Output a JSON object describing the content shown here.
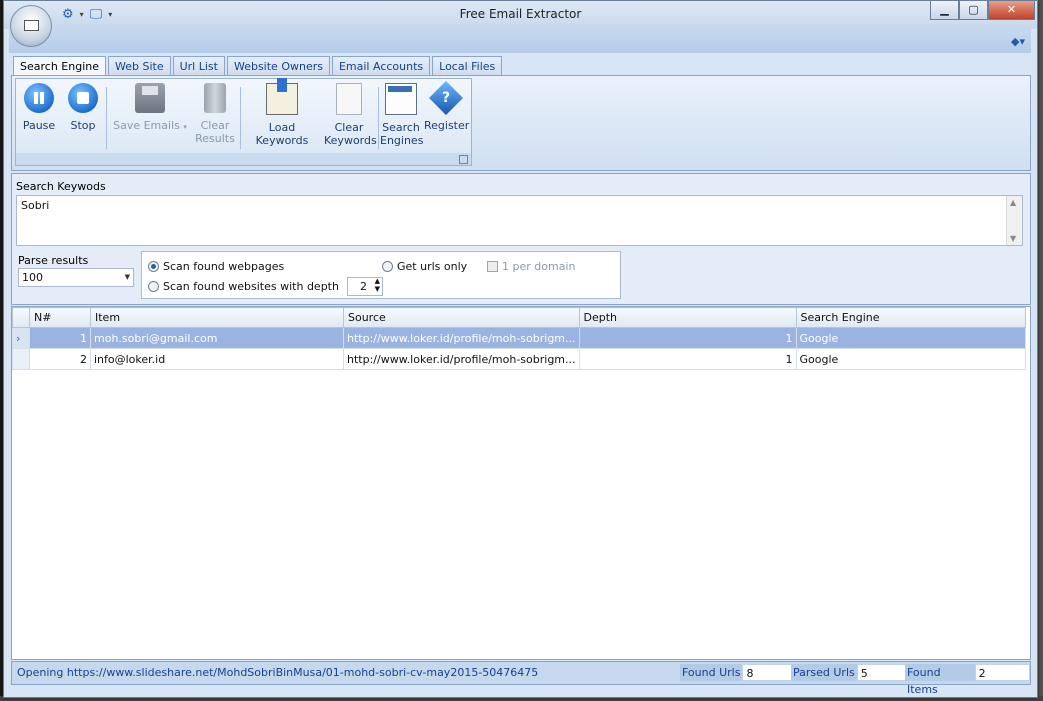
{
  "app": {
    "title": "Free Email Extractor"
  },
  "tabs": [
    "Search Engine",
    "Web Site",
    "Url List",
    "Website Owners",
    "Email Accounts",
    "Local Files"
  ],
  "ribbon": {
    "pause": "Pause",
    "stop": "Stop",
    "save_emails": "Save Emails",
    "clear_results": [
      "Clear",
      "Results"
    ],
    "load_keywords": "Load Keywords",
    "clear_keywords": [
      "Clear",
      "Keywords"
    ],
    "search_engines": [
      "Search",
      "Engines"
    ],
    "register": "Register"
  },
  "search": {
    "keywords_label": "Search Keywods",
    "keywords_value": "Sobri",
    "parse_label": "Parse results",
    "parse_value": "100",
    "opt_scan_found": "Scan found webpages",
    "opt_scan_depth": "Scan found websites with depth",
    "depth_value": "2",
    "opt_get_urls": "Get urls only",
    "opt_one_per_domain": "1 per domain"
  },
  "table": {
    "columns": [
      "N#",
      "Item",
      "Source",
      "Depth",
      "Search Engine"
    ],
    "rows": [
      {
        "n": "1",
        "item": "moh.sobri@gmail.com",
        "source": "http://www.loker.id/profile/moh-sobrigm...",
        "depth": "1",
        "engine": "Google"
      },
      {
        "n": "2",
        "item": "info@loker.id",
        "source": "http://www.loker.id/profile/moh-sobrigm...",
        "depth": "1",
        "engine": "Google"
      }
    ]
  },
  "status": {
    "message": "Opening https://www.slideshare.net/MohdSobriBinMusa/01-mohd-sobri-cv-may2015-50476475",
    "found_urls_label": "Found Urls",
    "found_urls_value": "8",
    "parsed_urls_label": "Parsed Urls",
    "parsed_urls_value": "5",
    "found_items_label": "Found Items",
    "found_items_value": "2"
  },
  "colors": {
    "accent": "#15428b",
    "selection": "#9ab3e0",
    "ribbon": "#d7e5f5"
  }
}
